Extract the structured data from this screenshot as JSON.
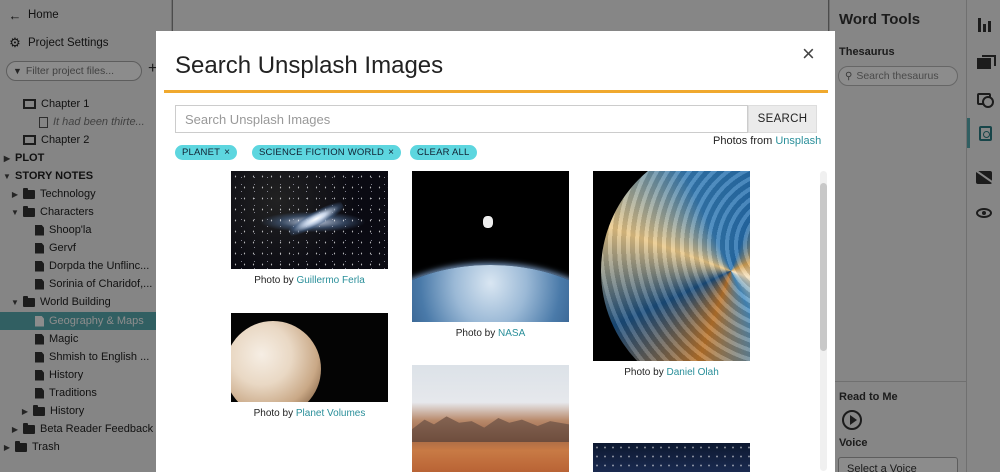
{
  "sidebar": {
    "home": "Home",
    "project_settings": "Project Settings",
    "filter_placeholder": "Filter project files...",
    "tree": [
      {
        "label": "Chapter 1",
        "kind": "book"
      },
      {
        "label": "It had been thirte...",
        "kind": "snippet"
      },
      {
        "label": "Chapter 2",
        "kind": "book"
      },
      {
        "label": "PLOT",
        "kind": "section"
      },
      {
        "label": "STORY NOTES",
        "kind": "section"
      },
      {
        "label": "Technology",
        "kind": "folder"
      },
      {
        "label": "Characters",
        "kind": "folder"
      },
      {
        "label": "Shoop'la",
        "kind": "doc"
      },
      {
        "label": "Gervf",
        "kind": "doc"
      },
      {
        "label": "Dorpda the Unflinc...",
        "kind": "doc"
      },
      {
        "label": "Sorinia of Charidof,...",
        "kind": "doc"
      },
      {
        "label": "World Building",
        "kind": "folder"
      },
      {
        "label": "Geography & Maps",
        "kind": "doc",
        "selected": true
      },
      {
        "label": "Magic",
        "kind": "doc"
      },
      {
        "label": "Shmish to English ...",
        "kind": "doc"
      },
      {
        "label": "History",
        "kind": "doc"
      },
      {
        "label": "Traditions",
        "kind": "doc"
      },
      {
        "label": "History",
        "kind": "folder"
      },
      {
        "label": "Beta Reader Feedback",
        "kind": "folder"
      },
      {
        "label": "Trash",
        "kind": "folder"
      }
    ]
  },
  "word_tools": {
    "title": "Word Tools",
    "thesaurus_label": "Thesaurus",
    "thesaurus_placeholder": "Search thesaurus",
    "read_to_me": "Read to Me",
    "voice_label": "Voice",
    "voice_select": "Select a Voice"
  },
  "icon_bar": [
    "stats-icon",
    "snapshots-icon",
    "history-icon",
    "image-search-icon",
    "comments-off-icon",
    "preview-icon"
  ],
  "modal": {
    "title": "Search Unsplash Images",
    "close": "×",
    "search_placeholder": "Search Unsplash Images",
    "search_button": "SEARCH",
    "credit_prefix": "Photos from ",
    "credit_link": "Unsplash",
    "chips": [
      "PLANET",
      "SCIENCE FICTION WORLD"
    ],
    "chip_remove": "×",
    "clear_all": "CLEAR ALL",
    "photo_by": "Photo by ",
    "photos": [
      {
        "author": "Guillermo Ferla",
        "subject": "galaxy"
      },
      {
        "author": "NASA",
        "subject": "astronaut above earth"
      },
      {
        "author": "Daniel Olah",
        "subject": "swirling planet bubble"
      },
      {
        "author": "Planet Volumes",
        "subject": "pale planet"
      },
      {
        "author": "",
        "subject": "desert rocks"
      },
      {
        "author": "",
        "subject": "starry sky"
      }
    ]
  },
  "colors": {
    "accent": "#5aaeb3",
    "rule": "#f0a92e",
    "chip": "#5dd6df",
    "link": "#2a8f9a"
  }
}
